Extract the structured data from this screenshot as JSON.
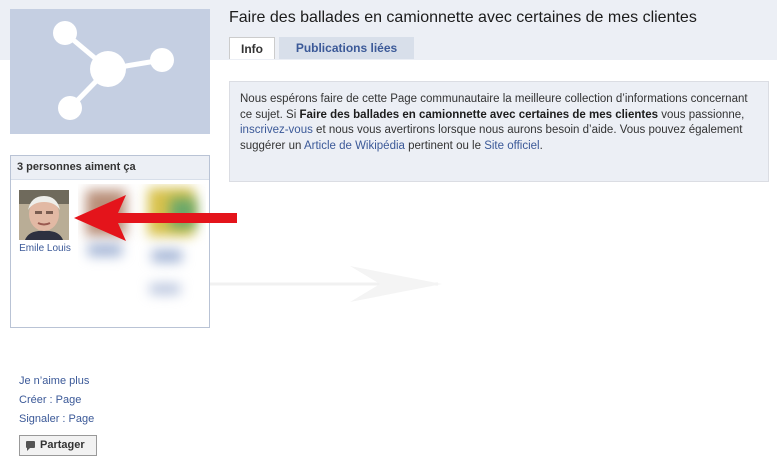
{
  "page": {
    "title": "Faire des ballades en camionnette avec certaines de mes clientes"
  },
  "tabs": [
    {
      "label": "Info",
      "active": true
    },
    {
      "label": "Publications liées",
      "active": false
    }
  ],
  "info": {
    "text1": "Nous espérons faire de cette Page communautaire la meilleure collection d’informations concernant ce sujet. Si ",
    "bold": "Faire des ballades en camionnette avec certaines de mes clientes",
    "text2": " vous passionne, ",
    "link1": "inscrivez-vous",
    "text3": " et nous vous avertirons lorsque nous aurons besoin d’aide. Vous pouvez également suggérer un ",
    "link2": "Article de Wikipédia",
    "text4": " pertinent ou le ",
    "link3": "Site officiel",
    "text5": "."
  },
  "likes": {
    "header": "3 personnes aiment ça",
    "fans": [
      {
        "name": "Emile Louis"
      }
    ]
  },
  "sidebar_links": [
    "Je n’aime plus",
    "Créer : Page",
    "Signaler : Page"
  ],
  "share": {
    "label": "Partager",
    "icon": "speech-bubble-icon"
  },
  "colors": {
    "link": "#3b5998",
    "band": "#eceff5",
    "placeholder": "#c5cfe2",
    "arrow": "#e4141b"
  }
}
